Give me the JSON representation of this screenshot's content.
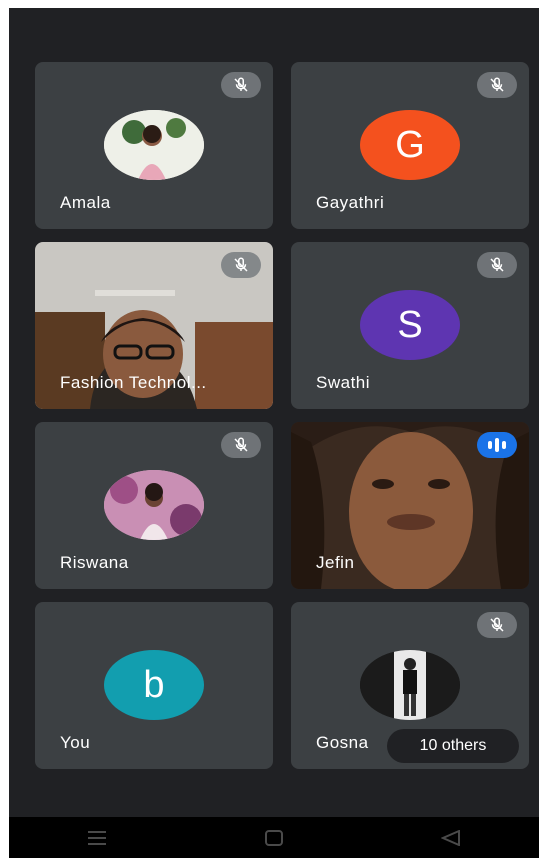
{
  "participants": [
    {
      "name": "Amala",
      "type": "photo",
      "muted": true
    },
    {
      "name": "Gayathri",
      "type": "initial",
      "initial": "G",
      "color": "#f4511e",
      "muted": true
    },
    {
      "name": "Fashion Technol...",
      "type": "video",
      "muted": true
    },
    {
      "name": "Swathi",
      "type": "initial",
      "initial": "S",
      "color": "#5e35b1",
      "muted": true
    },
    {
      "name": "Riswana",
      "type": "photo",
      "muted": true
    },
    {
      "name": "Jefin",
      "type": "video",
      "speaking": true
    },
    {
      "name": "You",
      "type": "initial",
      "initial": "b",
      "color": "#129eaf"
    },
    {
      "name": "Gosna",
      "type": "photo",
      "muted": true
    }
  ],
  "others_label": "10 others",
  "icons": {
    "mute": "mic-off-icon",
    "speaking": "audio-level-icon",
    "nav": [
      "recents-icon",
      "home-icon",
      "back-icon"
    ]
  }
}
